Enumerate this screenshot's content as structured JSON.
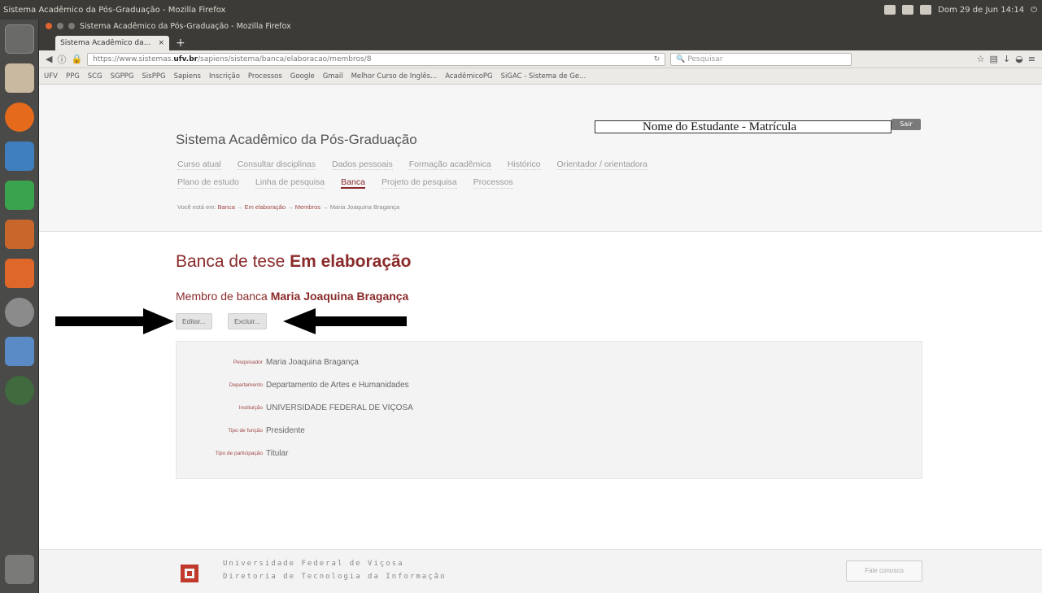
{
  "desktop": {
    "top_bar_title": "Sistema Acadêmico da Pós-Graduação - Mozilla Firefox",
    "clock": "Dom 29 de Jun 14:14"
  },
  "firefox": {
    "window_title": "Sistema Acadêmico da Pós-Graduação - Mozilla Firefox",
    "tab_label": "Sistema Acadêmico da...",
    "url_prefix": "https://www.sistemas.",
    "url_domain": "ufv.br",
    "url_suffix": "/sapiens/sistema/banca/elaboracao/membros/8",
    "search_placeholder": "Pesquisar",
    "bookmarks": [
      "UFV",
      "PPG",
      "SCG",
      "SGPPG",
      "SisPPG",
      "Sapiens",
      "Inscrição",
      "Processos",
      "Google",
      "Gmail",
      "Melhor Curso de Inglês...",
      "AcadêmicoPG",
      "SiGAC - Sistema de Ge..."
    ]
  },
  "site": {
    "title": "Sistema Acadêmico da Pós-Graduação",
    "user_box": "Nome do Estudante - Matrícula",
    "logout_label": "Sair",
    "menu_row1": [
      "Curso atual",
      "Consultar disciplinas",
      "Dados pessoais",
      "Formação acadêmica",
      "Histórico",
      "Orientador / orientadora"
    ],
    "menu_row2": [
      "Plano de estudo",
      "Linha de pesquisa",
      "Banca",
      "Projeto de pesquisa",
      "Processos"
    ],
    "breadcrumb": {
      "prefix": "Você está em:",
      "items": [
        "Banca",
        "Em elaboração",
        "Membros",
        "Maria Joaquina Bragança"
      ],
      "separator": "→"
    }
  },
  "content": {
    "title_prefix": "Banca de tese",
    "title_status": "Em elaboração",
    "subtitle_prefix": "Membro de banca",
    "subtitle_name": "Maria Joaquina Bragança",
    "edit_label": "Editar...",
    "delete_label": "Excluir...",
    "details": [
      {
        "label": "Pesquisador",
        "value": "Maria Joaquina Bragança"
      },
      {
        "label": "Departamento",
        "value": "Departamento de Artes e Humanidades"
      },
      {
        "label": "Instituição",
        "value": "UNIVERSIDADE FEDERAL DE VIÇOSA"
      },
      {
        "label": "Tipo de função",
        "value": "Presidente"
      },
      {
        "label": "Tipo de participação",
        "value": "Titular"
      }
    ]
  },
  "footer": {
    "line1": "Universidade Federal de Viçosa",
    "line2": "Diretoria de Tecnologia da Informação",
    "button": "Fale conosco"
  },
  "colors": {
    "brand": "#8a2a2a",
    "ubuntu_bar": "#3c3b37"
  }
}
